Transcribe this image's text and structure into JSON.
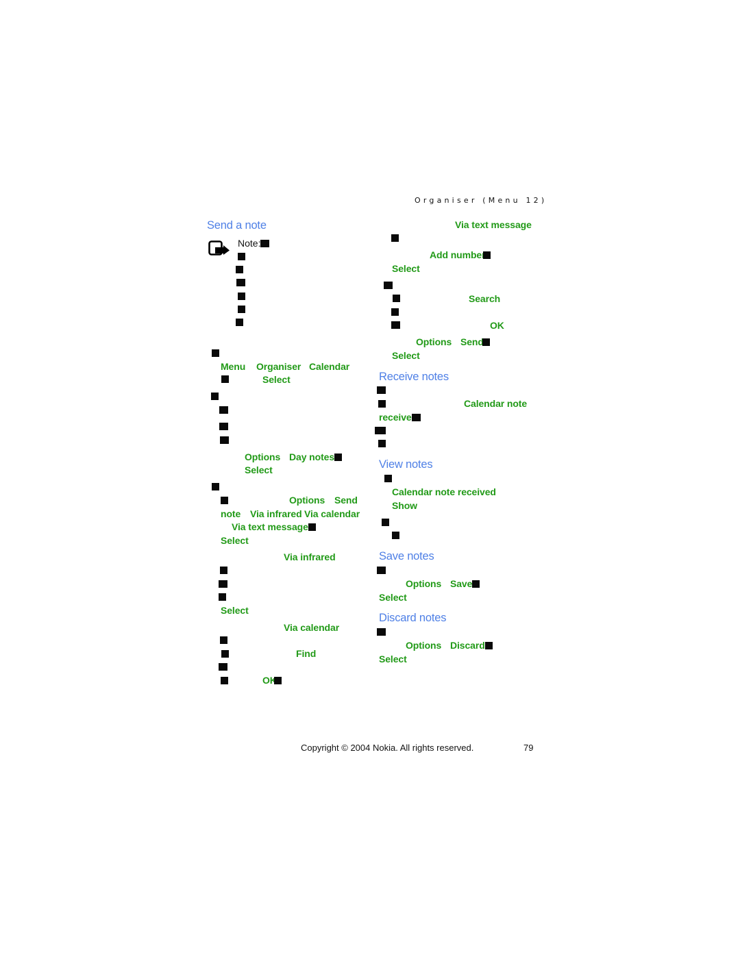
{
  "header": {
    "running_title": "Organiser (Menu 12)"
  },
  "left_column": {
    "heading": "Send a note",
    "note_label": "Note:",
    "steps": {
      "menu": "Menu",
      "organiser": "Organiser",
      "calendar": "Calendar",
      "select_1": "Select",
      "options_1": "Options",
      "day_notes": "Day notes",
      "select_2": "Select",
      "options_2": "Options",
      "send": "Send",
      "note": "note",
      "via_infrared": "Via infrared",
      "via_calendar": "Via calendar",
      "via_text_message": "Via text message",
      "select_3": "Select"
    },
    "infrared_section": {
      "title": "Via infrared",
      "select": "Select"
    },
    "calendar_section": {
      "title": "Via calendar",
      "find": "Find",
      "ok": "OK"
    }
  },
  "right_column": {
    "text_message_section": {
      "title": "Via text message",
      "add_number": "Add number",
      "select_1": "Select",
      "search": "Search",
      "ok": "OK",
      "options": "Options",
      "send": "Send",
      "select_2": "Select"
    },
    "receive_notes": {
      "heading": "Receive notes",
      "calendar_note": "Calendar note",
      "receive": "receive"
    },
    "view_notes": {
      "heading": "View notes",
      "calendar_note_received": "Calendar note received",
      "show": "Show"
    },
    "save_notes": {
      "heading": "Save notes",
      "options": "Options",
      "save": "Save",
      "select": "Select"
    },
    "discard_notes": {
      "heading": "Discard notes",
      "options": "Options",
      "discard": "Discard",
      "select": "Select"
    }
  },
  "footer": {
    "copyright": "Copyright © 2004 Nokia. All rights reserved.",
    "page_number": "79"
  },
  "colors": {
    "heading_blue": "#4f80e6",
    "keyword_green": "#229a18",
    "redaction_black": "#0a0a0a"
  }
}
